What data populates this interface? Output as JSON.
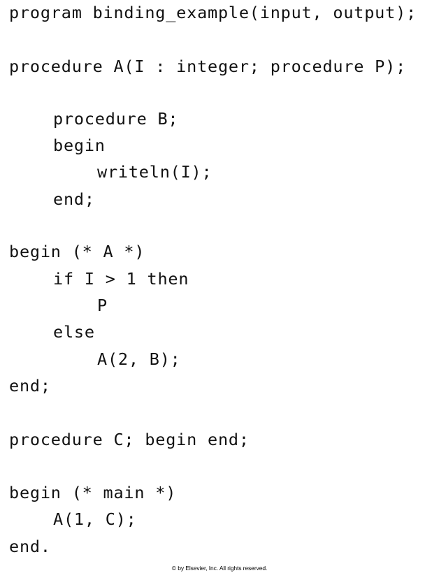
{
  "code": {
    "lines": [
      "program binding_example(input, output);",
      "procedure A(I : integer; procedure P);",
      "procedure B;",
      "begin",
      "writeln(I);",
      "end;",
      "begin (* A *)",
      "if I > 1 then",
      "P",
      "else",
      "A(2, B);",
      "end;",
      "procedure C; begin end;",
      "begin (* main *)",
      "A(1, C);",
      "end."
    ]
  },
  "footer": {
    "copyright": "© by Elsevier, Inc. All rights reserved."
  }
}
